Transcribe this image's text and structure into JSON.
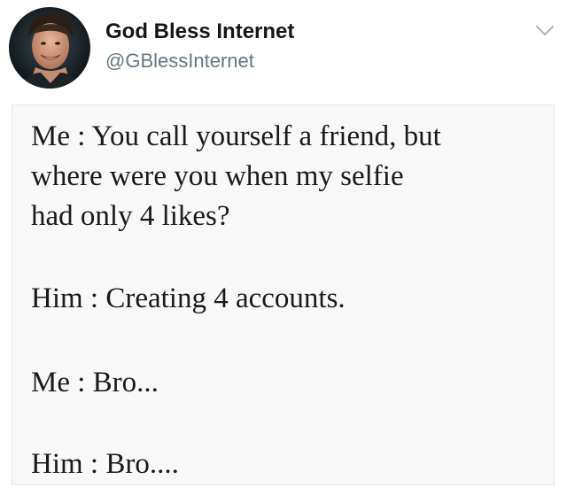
{
  "author": {
    "display_name": "God Bless Internet",
    "handle": "@GBlessInternet"
  },
  "icons": {
    "avatar": "profile-photo",
    "menu": "chevron-down-icon"
  },
  "colors": {
    "name": "#14171a",
    "handle": "#657786",
    "text": "#1a1a1a",
    "content_bg": "#f8f8f8"
  },
  "tweet": {
    "lines": [
      "Me : You call yourself a friend, but",
      "where were you when my selfie",
      "had only 4 likes?",
      "Him : Creating 4 accounts.",
      "Me : Bro...",
      "Him : Bro...."
    ]
  }
}
